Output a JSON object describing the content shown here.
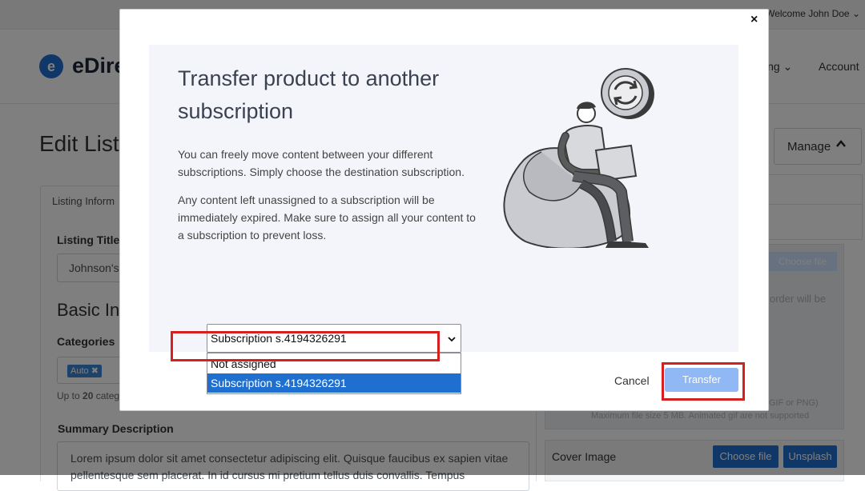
{
  "top_bar": {
    "welcome": "Welcome John Doe"
  },
  "header": {
    "logo_mark": "e",
    "logo_text": "eDire",
    "nav_listing": "ing",
    "nav_account": "Account"
  },
  "page": {
    "title": "Edit List",
    "manage_label": "Manage",
    "tab_label": "Listing Inform",
    "listing_title_label": "Listing Title",
    "listing_title_value": "Johnson's",
    "basic_info": "Basic Inf",
    "categories_label": "Categories",
    "category_tag": "Auto",
    "up_to_prefix": "Up to",
    "up_to_count": "20",
    "up_to_suffix": "categ",
    "summary_label": "Summary Description",
    "summary_text": "Lorem ipsum dolor sit amet consectetur adipiscing elit. Quisque faucibus ex sapien vitae pellentesque sem placerat. In id cursus mi pretium tellus duis convallis. Tempus"
  },
  "side": {
    "ghost_button": "Choose file",
    "ghost_text": "order will be",
    "ghost_small": "GIF or PNG)",
    "ghost_small2": "Maximum file size 5 MB. Animated gif are not supported",
    "cover_label": "Cover Image",
    "choose_file": "Choose file",
    "unsplash": "Unsplash"
  },
  "modal": {
    "title": "Transfer product to another subscription",
    "paragraph1": "You can freely move content between your different subscriptions. Simply choose the destination subscription.",
    "paragraph2": "Any content left unassigned to a subscription will be immediately expired. Make sure to assign all your content to a subscription to prevent loss.",
    "select_value": "Subscription s.4194326291",
    "options": [
      "Not assigned",
      "Subscription s.4194326291"
    ],
    "cancel_label": "Cancel",
    "transfer_label": "Transfer",
    "close_symbol": "×"
  },
  "colors": {
    "accent": "#1f6fd1",
    "highlight": "#d61f1f",
    "transfer_disabled": "#8fb8f5"
  }
}
